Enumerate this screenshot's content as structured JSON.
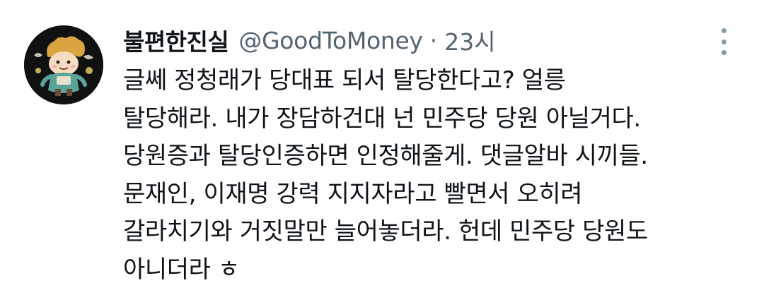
{
  "tweet": {
    "author": {
      "display_name": "불편한진실",
      "handle": "@GoodToMoney",
      "avatar_icon": "cartoon-character-avatar"
    },
    "separator": "·",
    "time": "23시",
    "more_icon": "more-vertical-icon",
    "text_lines": [
      "글쎄 정청래가 당대표 되서 탈당한다고? 얼릉",
      "탈당해라. 내가 장담하건대 넌 민주당 당원 아닐거다.",
      "당원증과 탈당인증하면 인정해줄게. 댓글알바 시끼들.",
      "문재인, 이재명 강력 지지자라고 빨면서 오히려",
      "갈라치기와 거짓말만 늘어놓더라. 헌데 민주당 당원도",
      "아니더라 ㅎ"
    ]
  },
  "colors": {
    "text_primary": "#0f1419",
    "text_secondary": "#536471",
    "avatar_bg": "#111111"
  }
}
